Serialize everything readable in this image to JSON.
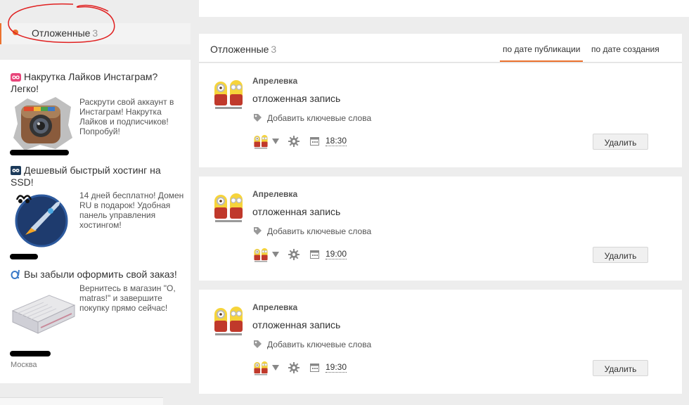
{
  "nav": {
    "label": "Отложенные",
    "count": "3"
  },
  "ads": [
    {
      "title": "Накрутка Лайков Инстаграм? Легко!",
      "text": "Раскрути свой аккаунт в Инстаграм! Накрутка Лайков и подписчиков! Попробуй!",
      "icon": "instagram-logo"
    },
    {
      "title": "Дешевый быстрый хостинг на SSD!",
      "text": "14 дней бесплатно! Домен RU в подарок! Удобная панель управления хостингом!",
      "icon": "rocket-logo"
    },
    {
      "title": "Вы забыли оформить свой заказ!",
      "text": "Вернитесь в магазин \"O, matras!\" и завершите покупку прямо сейчас!",
      "city": "Москва",
      "icon": "mattress-image"
    }
  ],
  "feed": {
    "title": "Отложенные",
    "count": "3",
    "sort_by_publication": "по дате публикации",
    "sort_by_creation": "по дате создания"
  },
  "posts": [
    {
      "author": "Апрелевка",
      "text": "отложенная запись",
      "tags_label": "Добавить ключевые слова",
      "time": "18:30",
      "delete_label": "Удалить"
    },
    {
      "author": "Апрелевка",
      "text": "отложенная запись",
      "tags_label": "Добавить ключевые слова",
      "time": "19:00",
      "delete_label": "Удалить"
    },
    {
      "author": "Апрелевка",
      "text": "отложенная запись",
      "tags_label": "Добавить ключевые слова",
      "time": "19:30",
      "delete_label": "Удалить"
    }
  ],
  "colors": {
    "accent": "#eb722e",
    "annotation": "#e02020"
  }
}
